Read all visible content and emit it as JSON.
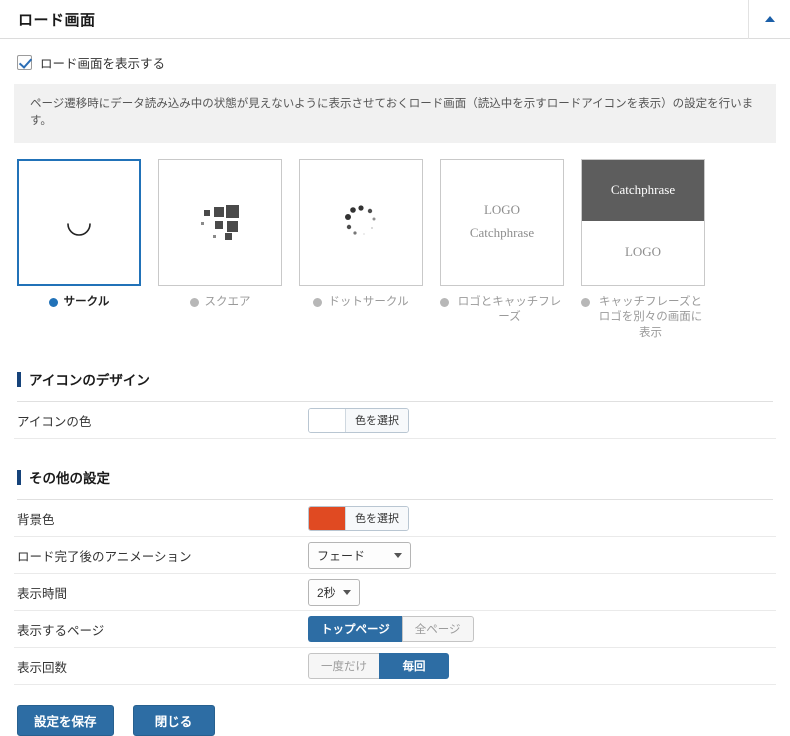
{
  "header": {
    "title": "ロード画面",
    "toggle_icon": "caret-up-icon"
  },
  "enable_checkbox": {
    "label": "ロード画面を表示する",
    "checked": true
  },
  "note": "ページ遷移時にデータ読み込み中の状態が見えないように表示させておくロード画面（読込中を示すロードアイコンを表示）の設定を行います。",
  "thumbnails": [
    {
      "label": "サークル",
      "selected": true,
      "kind": "circle-arc"
    },
    {
      "label": "スクエア",
      "selected": false,
      "kind": "squares"
    },
    {
      "label": "ドットサークル",
      "selected": false,
      "kind": "dot-circle"
    },
    {
      "label": "ロゴとキャッチフレーズ",
      "selected": false,
      "kind": "logo-catchphrase",
      "line1": "LOGO",
      "line2": "Catchphrase"
    },
    {
      "label": "キャッチフレーズとロゴを別々の画面に表示",
      "selected": false,
      "kind": "split",
      "top_text": "Catchphrase",
      "bottom_text": "LOGO"
    }
  ],
  "sections": {
    "icon_design": {
      "title": "アイコンのデザイン",
      "icon_color": {
        "label": "アイコンの色",
        "button_label": "色を選択",
        "value": "#ffffff"
      }
    },
    "other": {
      "title": "その他の設定",
      "bg_color": {
        "label": "背景色",
        "button_label": "色を選択",
        "value": "#e04a22"
      },
      "animation": {
        "label": "ロード完了後のアニメーション",
        "value": "フェード"
      },
      "duration": {
        "label": "表示時間",
        "value": "2秒"
      },
      "pages": {
        "label": "表示するページ",
        "options": [
          "トップページ",
          "全ページ"
        ],
        "selected_index": 0
      },
      "frequency": {
        "label": "表示回数",
        "options": [
          "一度だけ",
          "毎回"
        ],
        "selected_index": 1
      }
    }
  },
  "footer": {
    "save_label": "設定を保存",
    "close_label": "閉じる"
  }
}
